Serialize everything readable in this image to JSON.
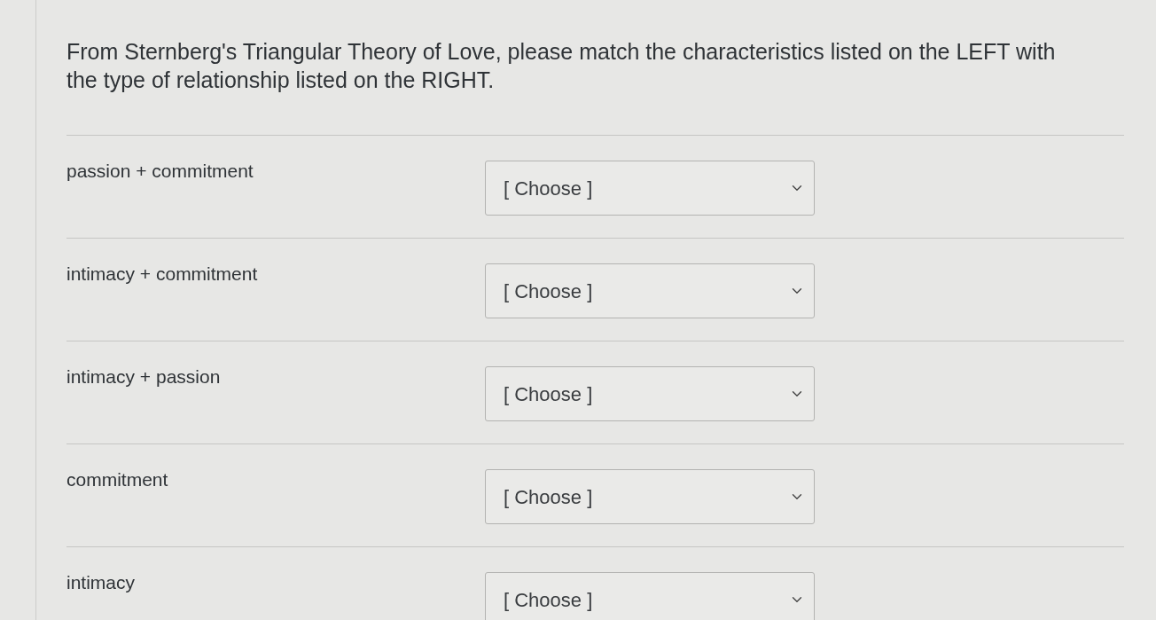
{
  "question": {
    "text": "From Sternberg's Triangular Theory of Love, please match the characteristics listed on the LEFT with the type of relationship listed on the RIGHT."
  },
  "matches": [
    {
      "characteristic": "passion + commitment",
      "select": {
        "value": "[ Choose ]"
      }
    },
    {
      "characteristic": "intimacy + commitment",
      "select": {
        "value": "[ Choose ]"
      }
    },
    {
      "characteristic": "intimacy + passion",
      "select": {
        "value": "[ Choose ]"
      }
    },
    {
      "characteristic": "commitment",
      "select": {
        "value": "[ Choose ]"
      }
    },
    {
      "characteristic": "intimacy",
      "select": {
        "value": "[ Choose ]"
      }
    }
  ]
}
